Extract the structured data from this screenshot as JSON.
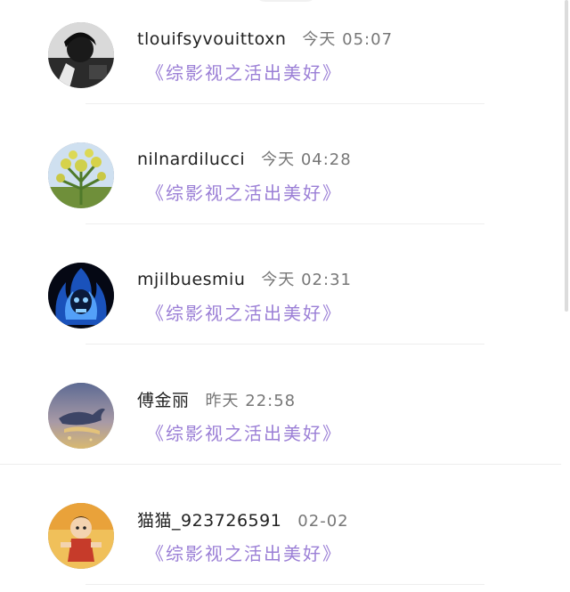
{
  "comments": [
    {
      "username": "tlouifsyvouittoxn",
      "time": "今天 05:07",
      "title": "《综影视之活出美好》",
      "avatar_icon": "avatar-dark-portrait"
    },
    {
      "username": "nilnardilucci",
      "time": "今天 04:28",
      "title": "《综影视之活出美好》",
      "avatar_icon": "avatar-flower-plant"
    },
    {
      "username": "mjilbuesmiu",
      "time": "今天 02:31",
      "title": "《综影视之活出美好》",
      "avatar_icon": "avatar-blue-flame-skull"
    },
    {
      "username": "傅金丽",
      "time": "昨天 22:58",
      "title": "《综影视之活出美好》",
      "avatar_icon": "avatar-whale-sky"
    },
    {
      "username": "猫猫_923726591",
      "time": "02-02",
      "title": "《综影视之活出美好》",
      "avatar_icon": "avatar-cartoon-figure"
    }
  ],
  "colors": {
    "title_purple": "#9b7fd6",
    "username": "#222222",
    "time_gray": "#777777"
  }
}
